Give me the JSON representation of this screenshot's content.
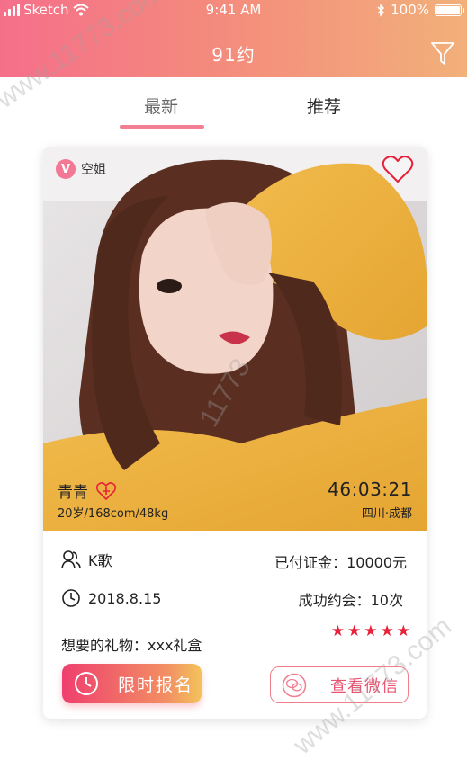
{
  "status_bar": {
    "carrier": "Sketch",
    "time": "9:41 AM",
    "battery_text": "100%",
    "battery_level": 1.0
  },
  "nav": {
    "title": "91约",
    "filter_icon": "filter-icon"
  },
  "tabs": [
    {
      "label": "最新",
      "active": true
    },
    {
      "label": "推荐",
      "active": false
    }
  ],
  "card": {
    "badge": {
      "icon": "v-badge-icon",
      "label": "空姐"
    },
    "name": "青青",
    "stats": "20岁/168com/48kg",
    "countdown": "46:03:21",
    "location": "四川·成都",
    "interest": "K歌",
    "deposit": "已付证金：10000元",
    "date": "2018.8.15",
    "dates_count": "成功约会：10次",
    "gift": "想要的礼物：xxx礼盒",
    "rating": 5,
    "signup_label": "限时报名",
    "wechat_label": "查看微信"
  },
  "watermarks": [
    "www.11773.com",
    "11773",
    "www.11773.com"
  ],
  "colors": {
    "accent": "#f47e93",
    "star": "#e8203a",
    "header_start": "#f56f8a",
    "header_end": "#f2b07a"
  }
}
